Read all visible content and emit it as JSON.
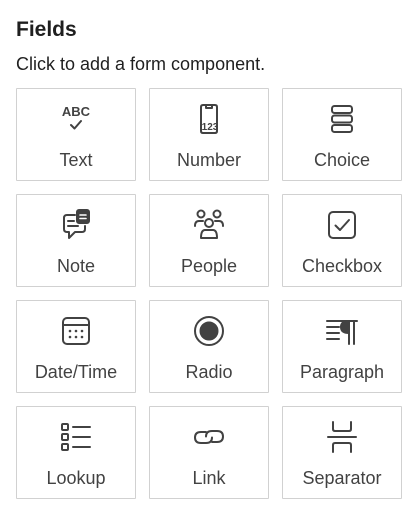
{
  "panel": {
    "title": "Fields",
    "subtitle": "Click to add a form component."
  },
  "fields": [
    {
      "label": "Text",
      "icon": "text-abc-icon"
    },
    {
      "label": "Number",
      "icon": "number-icon"
    },
    {
      "label": "Choice",
      "icon": "choice-icon"
    },
    {
      "label": "Note",
      "icon": "note-icon"
    },
    {
      "label": "People",
      "icon": "people-icon"
    },
    {
      "label": "Checkbox",
      "icon": "checkbox-icon"
    },
    {
      "label": "Date/Time",
      "icon": "calendar-icon"
    },
    {
      "label": "Radio",
      "icon": "radio-icon"
    },
    {
      "label": "Paragraph",
      "icon": "paragraph-icon"
    },
    {
      "label": "Lookup",
      "icon": "lookup-list-icon"
    },
    {
      "label": "Link",
      "icon": "link-icon"
    },
    {
      "label": "Separator",
      "icon": "separator-icon"
    }
  ],
  "icon_labels": {
    "text": "ABC",
    "number": "123"
  },
  "colors": {
    "icon_stroke": "#424242",
    "tile_border": "#d1d1d1",
    "text": "#1f1f1f"
  }
}
